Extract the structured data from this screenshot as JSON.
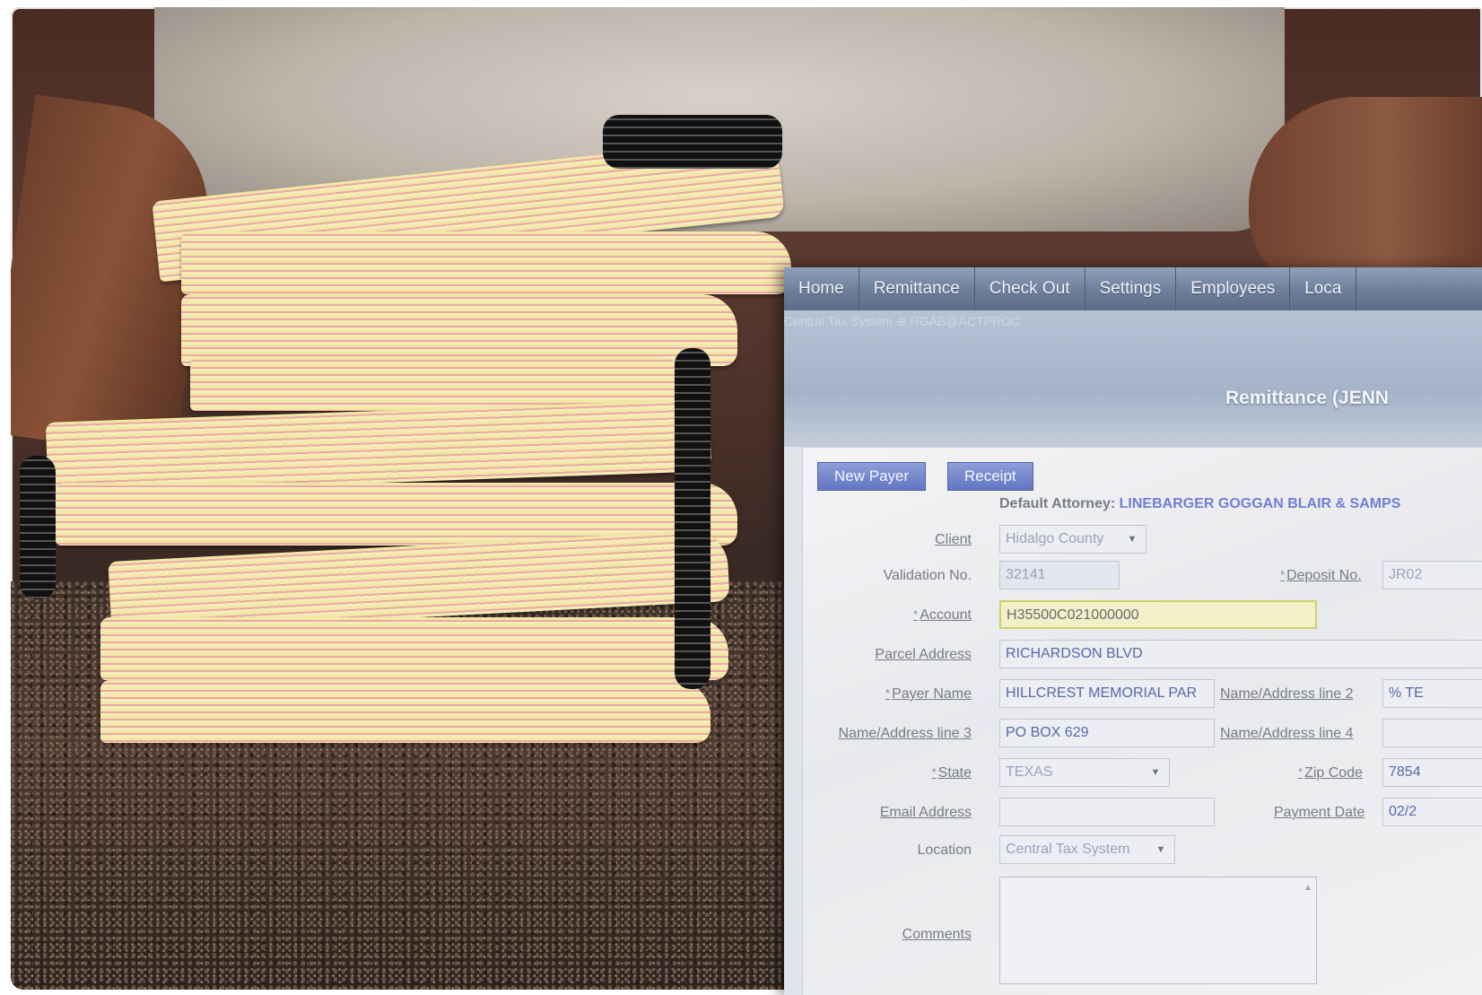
{
  "menu": [
    "Home",
    "Remittance",
    "Check Out",
    "Settings",
    "Employees",
    "Loca"
  ],
  "header": {
    "subtitle": "Central Tax System ⊕ RGAB@ACTPROC",
    "title": "Remittance (JENN"
  },
  "buttons": {
    "new_payer": "New Payer",
    "receipt": "Receipt"
  },
  "form": {
    "default_attorney_label": "Default Attorney:",
    "default_attorney_value": "LINEBARGER GOGGAN BLAIR & SAMPS",
    "client_label": "Client",
    "client_value": "Hidalgo County",
    "validation_label": "Validation No.",
    "validation_value": "32141",
    "deposit_label": "Deposit No.",
    "deposit_value": "JR02",
    "account_label": "Account",
    "account_value": "H35500C021000000",
    "parcel_label": "Parcel Address",
    "parcel_value": "RICHARDSON BLVD",
    "payer_label": "Payer Name",
    "payer_value": "HILLCREST MEMORIAL PAR",
    "addr2_label": "Name/Address line 2",
    "addr2_value": "% TE",
    "addr3_label": "Name/Address line 3",
    "addr3_value": "PO BOX 629",
    "addr4_label": "Name/Address line 4",
    "addr4_value": "",
    "state_label": "State",
    "state_value": "TEXAS",
    "zip_label": "Zip Code",
    "zip_value": "7854",
    "email_label": "Email Address",
    "email_value": "",
    "payment_date_label": "Payment Date",
    "payment_date_value": "02/2",
    "location_label": "Location",
    "location_value": "Central Tax System",
    "comments_label": "Comments",
    "required_mark": "*"
  }
}
